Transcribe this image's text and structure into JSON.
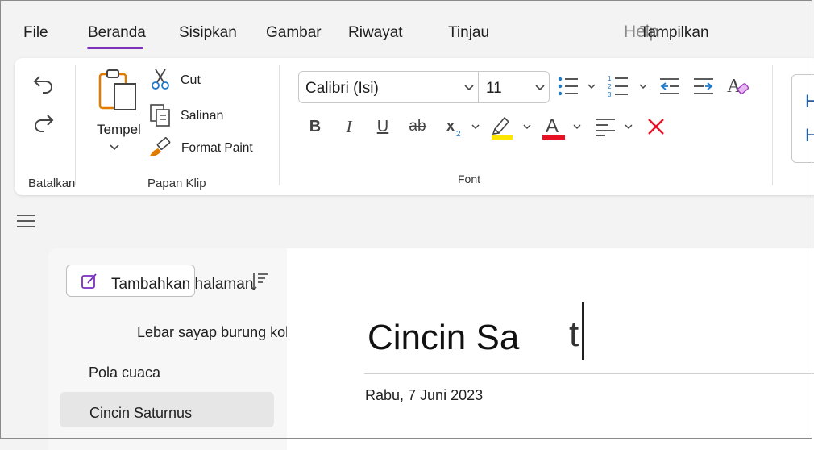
{
  "menu": {
    "items": [
      "File",
      "Beranda",
      "Sisipkan",
      "Gambar",
      "Riwayat",
      "Tinjau"
    ],
    "help_ghost": "Help",
    "view_label": "Tampilkan",
    "active": "Beranda"
  },
  "ribbon": {
    "undo_group": {
      "label": "Batalkan"
    },
    "clipboard": {
      "label": "Papan Klip",
      "paste": "Tempel",
      "cut": "Cut",
      "copy": "Salinan",
      "format_painter": "Format Paint"
    },
    "font": {
      "label": "Font",
      "name": "Calibri (Isi)",
      "size": "11"
    },
    "styles_preview": [
      "H",
      "H"
    ]
  },
  "pages": {
    "add_page": "Tambahkan halaman",
    "items": [
      "Lebar sayap burung kolibri",
      "Pola cuaca",
      "Cincin Saturnus"
    ],
    "selected": "Cincin Saturnus"
  },
  "note": {
    "title": "Cincin Sa",
    "title_tail": "t",
    "date": "Rabu, 7 Juni 2023"
  },
  "colors": {
    "accent": "#7b2fbf",
    "highlight": "#ffe600",
    "font_color": "#e81123",
    "clear": "#e81123",
    "list_blue": "#1f78c8"
  }
}
